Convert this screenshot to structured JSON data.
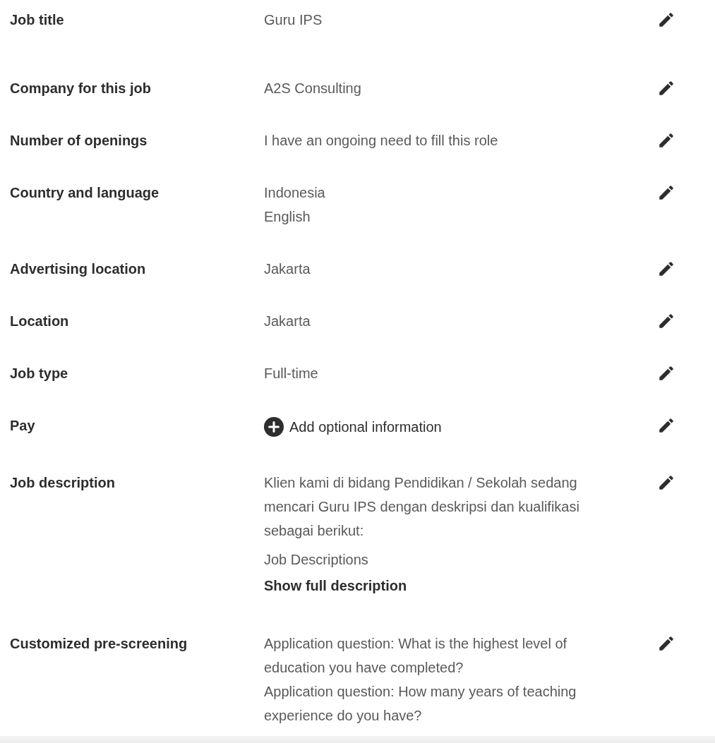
{
  "rows": [
    {
      "label": "Job title",
      "kind": "text",
      "values": [
        "Guru IPS"
      ]
    },
    {
      "label": "Company for this job",
      "kind": "text",
      "values": [
        "A2S Consulting"
      ]
    },
    {
      "label": "Number of openings",
      "kind": "text",
      "values": [
        "I have an ongoing need to fill this role"
      ]
    },
    {
      "label": "Country and language",
      "kind": "text",
      "values": [
        "Indonesia",
        "English"
      ]
    },
    {
      "label": "Advertising location",
      "kind": "text",
      "values": [
        "Jakarta"
      ]
    },
    {
      "label": "Location",
      "kind": "text",
      "values": [
        "Jakarta"
      ]
    },
    {
      "label": "Job type",
      "kind": "text",
      "values": [
        "Full-time"
      ]
    },
    {
      "label": "Pay",
      "kind": "add",
      "action": "Add optional information"
    },
    {
      "label": "Job description",
      "kind": "description",
      "values": [
        "Klien kami di bidang Pendidikan / Sekolah sedang mencari Guru IPS dengan deskripsi dan kualifikasi sebagai berikut:",
        "Job Descriptions"
      ],
      "link": "Show full description"
    },
    {
      "label": "Customized pre-screening",
      "kind": "text",
      "values": [
        "Application question: What is the highest level of education you have completed?",
        "Application question: How many years of teaching experience do you have?"
      ]
    }
  ]
}
